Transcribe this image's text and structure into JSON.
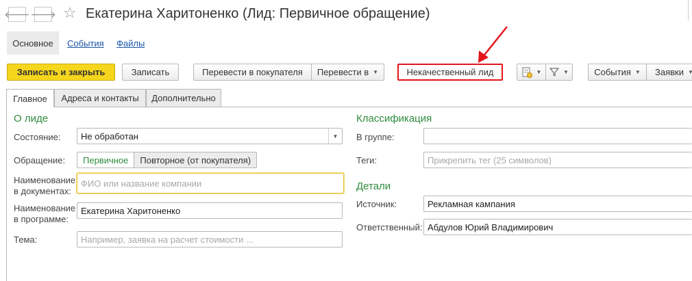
{
  "window": {
    "title": "Екатерина Харитоненко (Лид: Первичное обращение)"
  },
  "nav": {
    "back_glyph": "🡐",
    "forward_glyph": "🡒",
    "star_glyph": "☆"
  },
  "sections": [
    {
      "label": "Основное"
    },
    {
      "label": "События"
    },
    {
      "label": "Файлы"
    }
  ],
  "toolbar": {
    "save_close": "Записать и закрыть",
    "save": "Записать",
    "convert_buyer": "Перевести в покупателя",
    "convert_to": "Перевести в",
    "bad_lead": "Некачественный лид",
    "events": "События",
    "requests": "Заявки"
  },
  "tabs": [
    {
      "label": "Главное"
    },
    {
      "label": "Адреса и контакты"
    },
    {
      "label": "Дополнительно"
    }
  ],
  "about": {
    "header": "О лиде",
    "state_label": "Состояние:",
    "state_value": "Не обработан",
    "appeal_label": "Обращение:",
    "appeal_primary": "Первичное",
    "appeal_repeat": "Повторное (от покупателя)",
    "docname_label_1": "Наименование",
    "docname_label_2": "в документах:",
    "docname_placeholder": "ФИО или название компании",
    "progname_label_1": "Наименование",
    "progname_label_2": "в программе:",
    "progname_value": "Екатерина Харитоненко",
    "topic_label": "Тема:",
    "topic_placeholder": "Например, заявка на расчет стоимости ..."
  },
  "classification": {
    "header": "Классификация",
    "group_label": "В группе:",
    "group_value": "",
    "tags_label": "Теги:",
    "tags_placeholder": "Прикрепить тег (25 символов)"
  },
  "details": {
    "header": "Детали",
    "source_label": "Источник:",
    "source_value": "Рекламная кампания",
    "responsible_label": "Ответственный:",
    "responsible_value": "Абдулов Юрий Владимирович"
  },
  "colors": {
    "accent_green": "#2e8b3d",
    "primary_yellow": "#f6d61d",
    "highlight_red": "#e3141b",
    "link_blue": "#1a55a6"
  }
}
